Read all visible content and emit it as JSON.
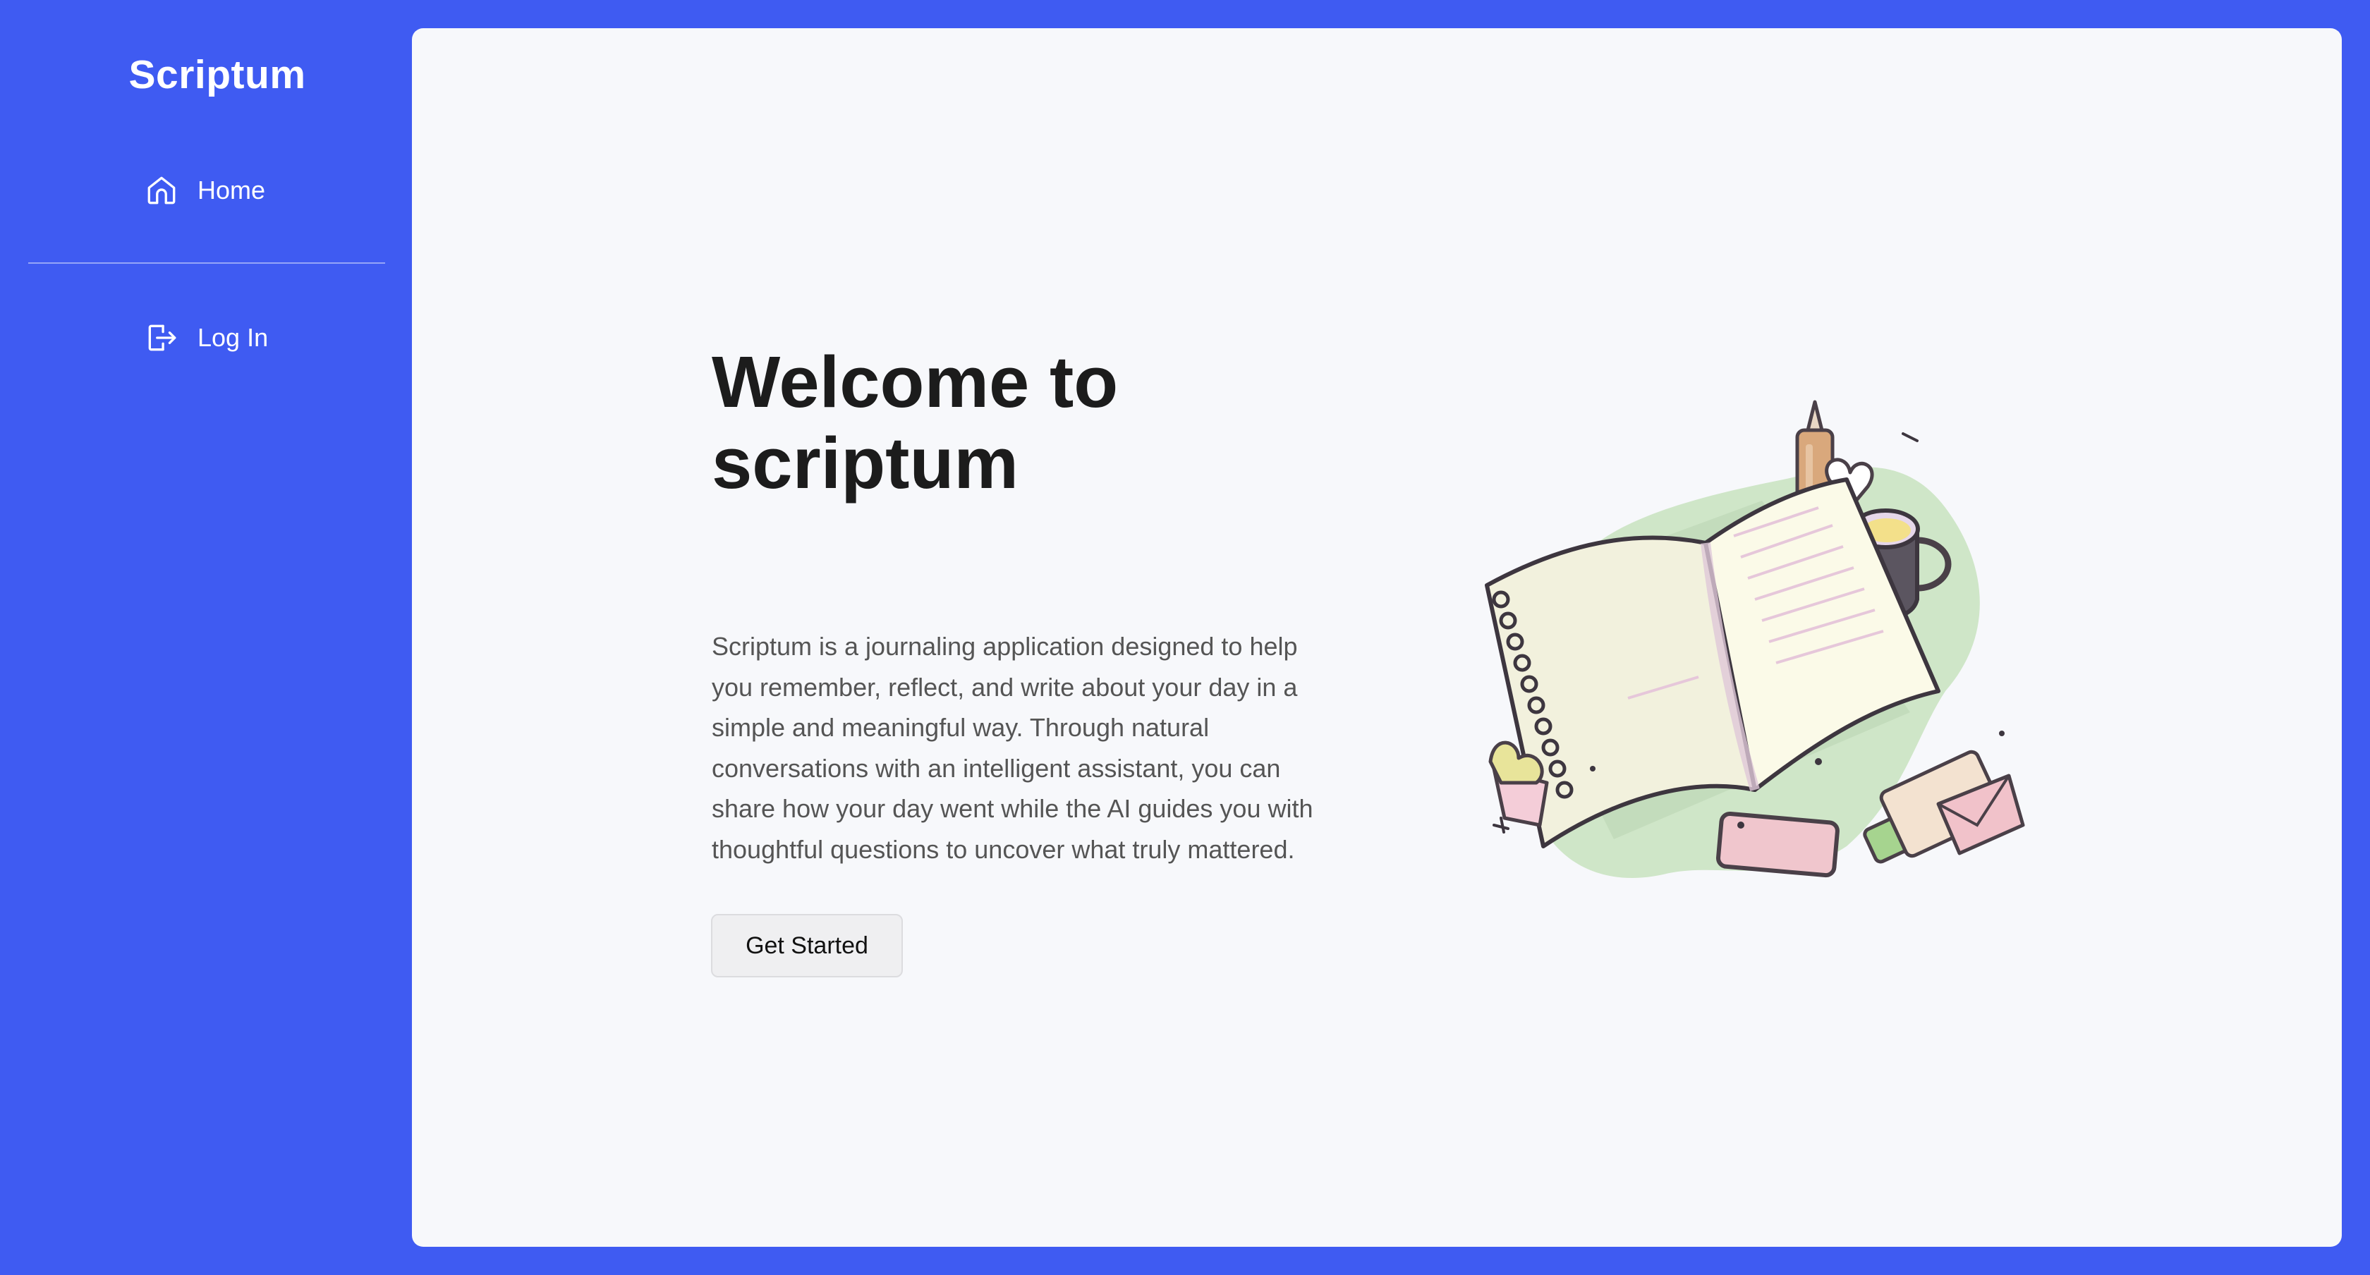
{
  "app": {
    "name": "Scriptum"
  },
  "sidebar": {
    "items": [
      {
        "label": "Home",
        "icon": "home-icon"
      },
      {
        "label": "Log In",
        "icon": "log-in-icon"
      }
    ]
  },
  "hero": {
    "title_line1": "Welcome to",
    "title_line2": "scriptum",
    "description": "Scriptum is a journaling application designed to help you remember, reflect, and write about your day in a simple and meaningful way. Through natural conversations with an intelligent assistant, you can share how your day went while the AI guides you with thoughtful questions to uncover what truly mattered.",
    "cta_label": "Get Started"
  },
  "colors": {
    "sidebar_background": "#3f5bf2",
    "content_background": "#f7f8fb",
    "title_text": "#1c1c1c",
    "body_text": "#555555",
    "button_background": "#efeff1"
  }
}
